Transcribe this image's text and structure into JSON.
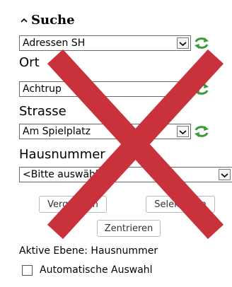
{
  "search": {
    "title": "Suche",
    "layer_select": {
      "value": "Adressen SH"
    },
    "ort_label": "Ort",
    "ort_select": {
      "value": "Achtrup"
    },
    "strasse_label": "Strasse",
    "strasse_select": {
      "value": "Am Spielplatz"
    },
    "hausnummer_label": "Hausnummer",
    "hausnummer_select": {
      "value": "<Bitte auswählen>"
    },
    "buttons": {
      "vergroessern": "Vergrößern",
      "selektieren": "Selektieren",
      "zentrieren": "Zentrieren"
    },
    "active_layer": "Aktive Ebene: Hausnummer",
    "auto_select_label": "Automatische Auswahl",
    "auto_select_checked": false
  },
  "colors": {
    "overlay_cross": "#c9323b",
    "refresh_icon": "#3a9a3a"
  },
  "icons": {
    "collapse": "chevron-up-icon",
    "refresh": "refresh-icon",
    "dropdown": "chevron-down-icon",
    "overlay": "red-cross-overlay"
  }
}
